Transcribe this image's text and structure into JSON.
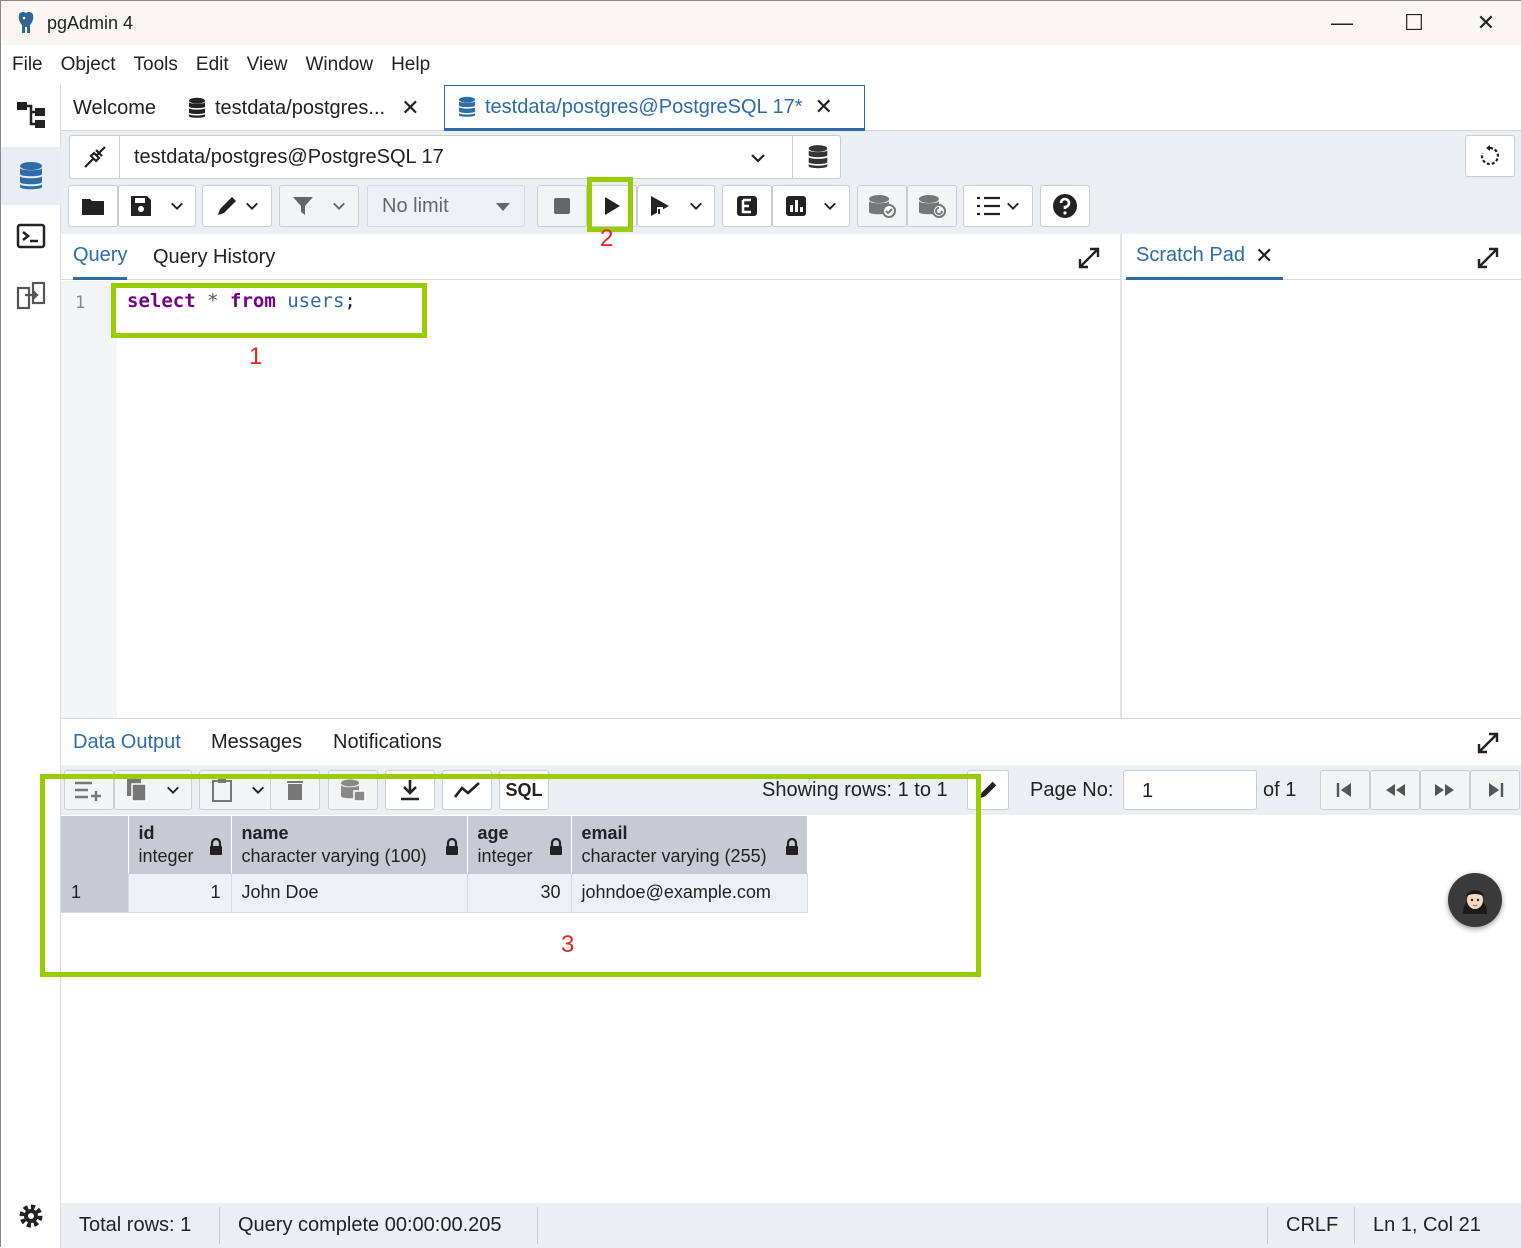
{
  "window": {
    "title": "pgAdmin 4",
    "minimize": "—",
    "maximize": "☐",
    "close": "✕"
  },
  "menu": [
    "File",
    "Object",
    "Tools",
    "Edit",
    "View",
    "Window",
    "Help"
  ],
  "tabs": [
    {
      "label": "Welcome"
    },
    {
      "label": "testdata/postgres...",
      "close": "✕"
    },
    {
      "label": "testdata/postgres@PostgreSQL 17*",
      "close": "✕"
    }
  ],
  "connection": {
    "value": "testdata/postgres@PostgreSQL 17"
  },
  "toolbar": {
    "limit": "No limit"
  },
  "query_tabs": [
    "Query",
    "Query History"
  ],
  "scratch": {
    "label": "Scratch Pad",
    "close": "✕"
  },
  "editor": {
    "line": "1",
    "kw1": "select",
    "star": "*",
    "kw2": "from",
    "table": "users",
    "semi": ";"
  },
  "output_tabs": [
    "Data Output",
    "Messages",
    "Notifications"
  ],
  "output": {
    "sql_label": "SQL",
    "showing": "Showing rows: 1 to 1",
    "page_label": "Page No:",
    "page_value": "1",
    "of": "of 1"
  },
  "grid": {
    "columns": [
      {
        "name": "id",
        "type": "integer"
      },
      {
        "name": "name",
        "type": "character varying (100)"
      },
      {
        "name": "age",
        "type": "integer"
      },
      {
        "name": "email",
        "type": "character varying (255)"
      }
    ],
    "rows": [
      {
        "rownum": "1",
        "id": "1",
        "name": "John Doe",
        "age": "30",
        "email": "johndoe@example.com"
      }
    ]
  },
  "status": {
    "total": "Total rows: 1",
    "query": "Query complete 00:00:00.205",
    "eol": "CRLF",
    "pos": "Ln 1, Col 21"
  },
  "annotations": {
    "a1": "1",
    "a2": "2",
    "a3": "3",
    "color": "#9acd00",
    "label_color": "#e8261e"
  },
  "colors": {
    "accent": "#2d6ca8",
    "keyword": "#770088"
  }
}
